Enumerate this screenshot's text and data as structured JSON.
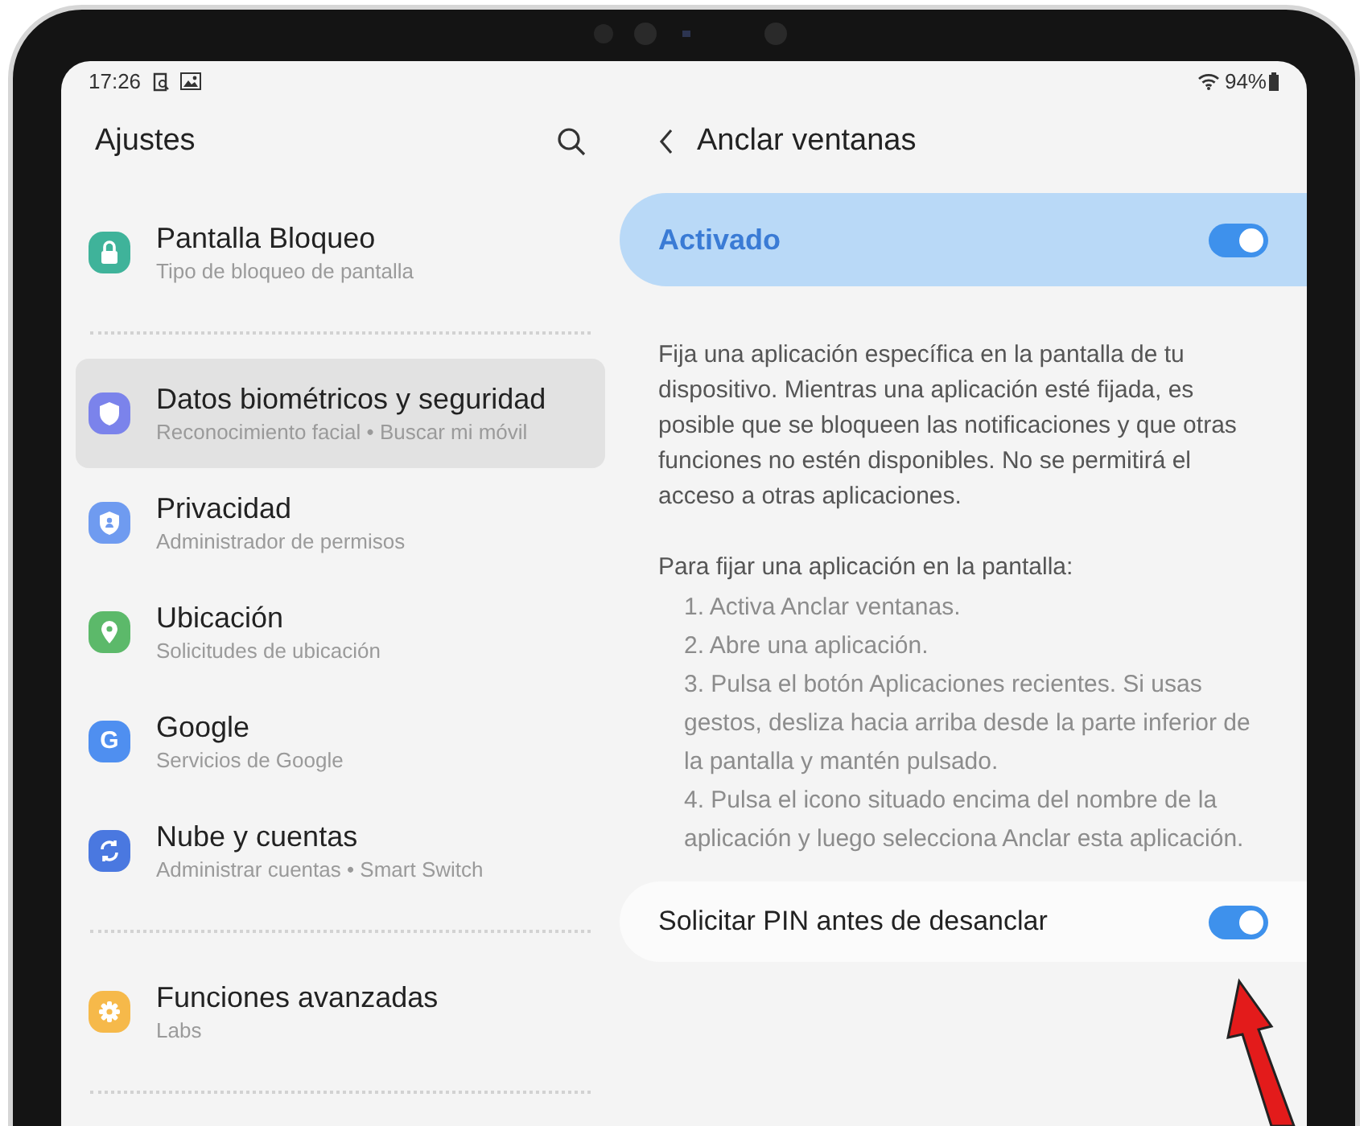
{
  "status_bar": {
    "time": "17:26",
    "battery": "94%"
  },
  "settings": {
    "title": "Ajustes",
    "groups": [
      {
        "items": [
          {
            "title": "Pantalla Bloqueo",
            "subtitle": "Tipo de bloqueo de pantalla",
            "kind": "lock",
            "color": "#3fb39a",
            "selected": false
          }
        ]
      },
      {
        "items": [
          {
            "title": "Datos biométricos y seguridad",
            "subtitle": "Reconocimiento facial • Buscar mi móvil",
            "kind": "shield",
            "color": "#7b83eb",
            "selected": true
          },
          {
            "title": "Privacidad",
            "subtitle": "Administrador de permisos",
            "kind": "privacy",
            "color": "#6f9bf0",
            "selected": false
          },
          {
            "title": "Ubicación",
            "subtitle": "Solicitudes de ubicación",
            "kind": "pin",
            "color": "#5cb96a",
            "selected": false
          },
          {
            "title": "Google",
            "subtitle": "Servicios de Google",
            "kind": "letter",
            "glyph": "G",
            "color": "#4f8ff0",
            "selected": false
          },
          {
            "title": "Nube y cuentas",
            "subtitle": "Administrar cuentas • Smart Switch",
            "kind": "sync",
            "color": "#4a78e0",
            "selected": false
          }
        ]
      },
      {
        "items": [
          {
            "title": "Funciones avanzadas",
            "subtitle": "Labs",
            "kind": "gear",
            "color": "#f6b94a",
            "selected": false
          }
        ]
      }
    ]
  },
  "detail": {
    "title": "Anclar ventanas",
    "master_switch": {
      "label": "Activado",
      "on": true
    },
    "description": "Fija una aplicación específica en la pantalla de tu dispositivo. Mientras una aplicación esté fijada, es posible que se bloqueen las notificaciones y que otras funciones no estén disponibles. No se permitirá el acceso a otras aplicaciones.",
    "instructions_title": "Para fijar una aplicación en la pantalla:",
    "steps": [
      "1. Activa Anclar ventanas.",
      "2. Abre una aplicación.",
      "3. Pulsa el botón Aplicaciones recientes. Si usas gestos, desliza hacia arriba desde la parte inferior de la pantalla y mantén pulsado.",
      "4. Pulsa el icono situado encima del nombre de la aplicación y luego selecciona Anclar esta aplicación."
    ],
    "pin_switch": {
      "label": "Solicitar PIN antes de desanclar",
      "on": true
    }
  }
}
